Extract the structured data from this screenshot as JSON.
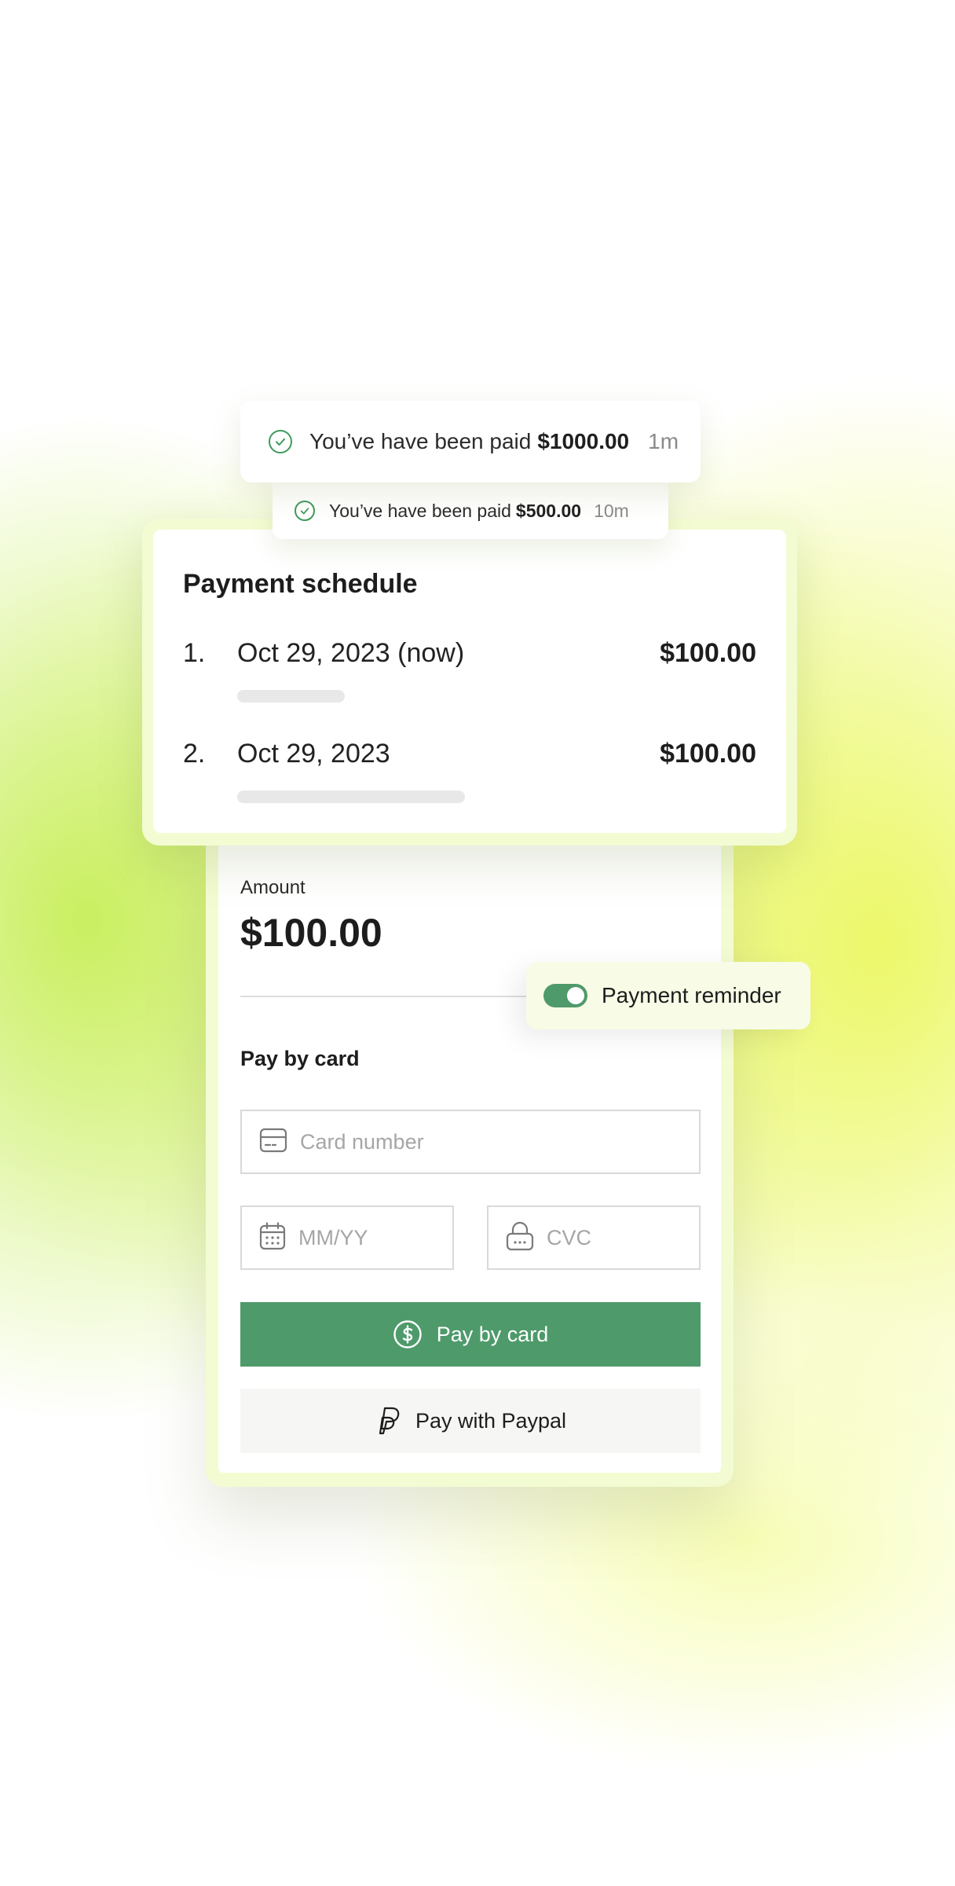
{
  "colors": {
    "accent_green": "#4e9a6b",
    "check_green": "#3f9a5c",
    "frame_tint": "#f3fbd2",
    "background_glow": "#d8f06a"
  },
  "notifications": [
    {
      "icon": "check-circle-icon",
      "text": "You’ve have been paid",
      "amount": "$1000.00",
      "time": "1m"
    },
    {
      "icon": "check-circle-icon",
      "text": "You’ve have been paid",
      "amount": "$500.00",
      "time": "10m"
    }
  ],
  "schedule": {
    "title": "Payment schedule",
    "items": [
      {
        "number": "1.",
        "date": "Oct 29, 2023 (now)",
        "amount": "$100.00"
      },
      {
        "number": "2.",
        "date": "Oct 29, 2023",
        "amount": "$100.00"
      }
    ]
  },
  "payment": {
    "amount_label": "Amount",
    "amount_value": "$100.00",
    "pay_by_card_heading": "Pay by card",
    "card_number": {
      "placeholder": "Card number",
      "icon": "credit-card-icon"
    },
    "expiry": {
      "placeholder": "MM/YY",
      "icon": "calendar-icon"
    },
    "cvc": {
      "placeholder": "CVC",
      "icon": "lock-icon"
    },
    "pay_card_button": {
      "label": "Pay by card",
      "icon": "dollar-circle-icon"
    },
    "paypal_button": {
      "label": "Pay with Paypal",
      "icon": "paypal-icon"
    }
  },
  "reminder": {
    "label": "Payment reminder",
    "enabled": true
  }
}
